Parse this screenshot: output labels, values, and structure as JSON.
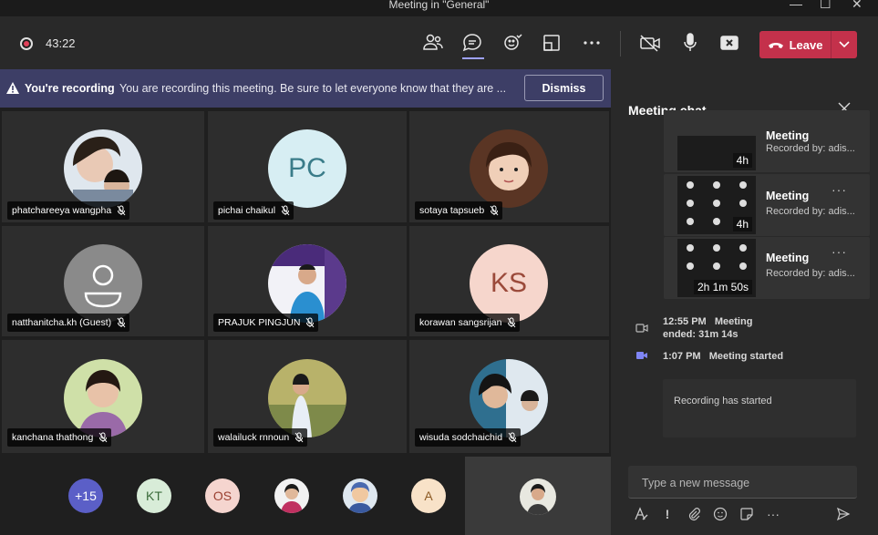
{
  "window": {
    "title": "Meeting in \"General\""
  },
  "toolbar": {
    "timer": "43:22",
    "leave_label": "Leave"
  },
  "banner": {
    "bold": "You're recording",
    "text": "You are recording this meeting. Be sure to let everyone know that they are ...",
    "dismiss_label": "Dismiss"
  },
  "participants": [
    {
      "name": "phatchareeya wangpha",
      "initials": "",
      "bg": "#b9c8d6"
    },
    {
      "name": "pichai chaikul",
      "initials": "PC",
      "bg": "#d7eef3",
      "fg": "#3a7c89"
    },
    {
      "name": "sotaya tapsueb",
      "initials": "",
      "bg": "#8b5a3f"
    },
    {
      "name": "natthanitcha.kh (Guest)",
      "initials": "",
      "bg": "#8a8a8a"
    },
    {
      "name": "PRAJUK PINGJUN",
      "initials": "",
      "bg": "#4a2b7a"
    },
    {
      "name": "korawan sangsrijan",
      "initials": "KS",
      "bg": "#f6d6cc",
      "fg": "#9b4a3a"
    },
    {
      "name": "kanchana thathong",
      "initials": "",
      "bg": "#8b6a9a"
    },
    {
      "name": "walailuck rnnoun",
      "initials": "",
      "bg": "#b8b26a"
    },
    {
      "name": "wisuda sodchaichid",
      "initials": "",
      "bg": "#2f6f8f"
    }
  ],
  "bottom_strip": [
    {
      "label": "+15",
      "bg": "#5b5fc7",
      "fg": "#ffffff"
    },
    {
      "label": "KT",
      "bg": "#d8ecd8",
      "fg": "#3b6b3b"
    },
    {
      "label": "OS",
      "bg": "#f5d5cf",
      "fg": "#9a3f30"
    },
    {
      "label": "",
      "bg": "#c8a08a",
      "fg": "#fff"
    },
    {
      "label": "",
      "bg": "#6a7fb0",
      "fg": "#fff"
    },
    {
      "label": "A",
      "bg": "#f8e2c8",
      "fg": "#8c5a25"
    }
  ],
  "chat": {
    "title": "Meeting chat",
    "recordings": [
      {
        "name": "Meeting",
        "by": "Recorded by: adis...",
        "duration": "4h"
      },
      {
        "name": "Meeting",
        "by": "Recorded by: adis...",
        "duration": "4h"
      },
      {
        "name": "Meeting",
        "by": "Recorded by: adis...",
        "duration": "2h 1m 50s"
      }
    ],
    "events": [
      {
        "time": "12:55 PM",
        "text": "Meeting",
        "text2": "ended: 31m 14s"
      },
      {
        "time": "1:07 PM",
        "text": "Meeting started"
      }
    ],
    "recording_started": "Recording has started",
    "input_placeholder": "Type a new message"
  },
  "colors": {
    "accent": "#9ea2ff",
    "leave": "#c4314b",
    "banner": "#3d3e66"
  }
}
